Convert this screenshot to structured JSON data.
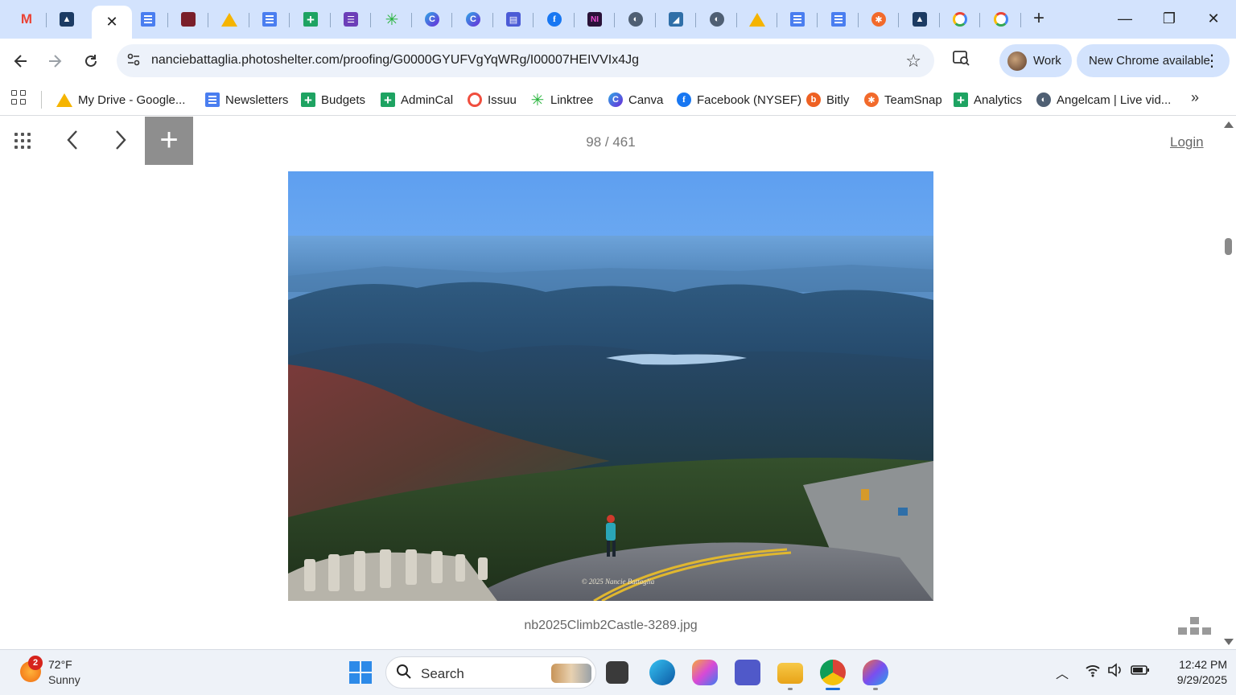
{
  "browser": {
    "active_tab_close": "✕",
    "new_tab": "+",
    "window_controls": {
      "minimize": "—",
      "restore": "❐",
      "close": "✕"
    },
    "url": "nanciebattaglia.photoshelter.com/proofing/G0000GYUFVgYqWRg/I00007HEIVVIx4Jg",
    "profile_label": "Work",
    "update_label": "New Chrome available"
  },
  "tabs": [
    {
      "icon": "gmail-icon",
      "glyph": "M"
    },
    {
      "icon": "photoshelter-icon",
      "glyph": "▲"
    },
    {
      "icon": "close-icon",
      "glyph": "✕",
      "active": true
    },
    {
      "icon": "google-docs-icon",
      "glyph": ""
    },
    {
      "icon": "unknown-site-icon",
      "glyph": ""
    },
    {
      "icon": "google-drive-icon",
      "glyph": ""
    },
    {
      "icon": "google-docs-icon",
      "glyph": ""
    },
    {
      "icon": "google-sheets-icon",
      "glyph": ""
    },
    {
      "icon": "google-forms-icon",
      "glyph": "☰"
    },
    {
      "icon": "linktree-icon",
      "glyph": "✳"
    },
    {
      "icon": "canva-icon",
      "glyph": "C"
    },
    {
      "icon": "canva-icon",
      "glyph": "C"
    },
    {
      "icon": "printer-icon",
      "glyph": "▤"
    },
    {
      "icon": "facebook-icon",
      "glyph": "f"
    },
    {
      "icon": "ni-icon",
      "glyph": "NI"
    },
    {
      "icon": "globe-icon",
      "glyph": "◐"
    },
    {
      "icon": "image-site-icon",
      "glyph": "◢"
    },
    {
      "icon": "globe-icon",
      "glyph": "◐"
    },
    {
      "icon": "google-drive-icon",
      "glyph": ""
    },
    {
      "icon": "google-docs-icon",
      "glyph": ""
    },
    {
      "icon": "google-docs-icon",
      "glyph": ""
    },
    {
      "icon": "teamsnap-icon",
      "glyph": "✱"
    },
    {
      "icon": "photoshelter-icon",
      "glyph": "▲"
    },
    {
      "icon": "google-icon",
      "glyph": "G"
    },
    {
      "icon": "google-icon",
      "glyph": "G"
    }
  ],
  "bookmarks": [
    {
      "label": "My Drive - Google...",
      "icon": "google-drive-icon"
    },
    {
      "label": "Newsletters",
      "icon": "google-docs-icon"
    },
    {
      "label": "Budgets",
      "icon": "google-sheets-icon"
    },
    {
      "label": "AdminCal",
      "icon": "google-sheets-icon"
    },
    {
      "label": "Issuu",
      "icon": "issuu-icon"
    },
    {
      "label": "Linktree",
      "icon": "linktree-icon"
    },
    {
      "label": "Canva",
      "icon": "canva-icon"
    },
    {
      "label": "Facebook (NYSEF)",
      "icon": "facebook-icon"
    },
    {
      "label": "Bitly",
      "icon": "bitly-icon"
    },
    {
      "label": "TeamSnap",
      "icon": "teamsnap-icon"
    },
    {
      "label": "Analytics",
      "icon": "google-sheets-icon"
    },
    {
      "label": "Angelcam | Live vid...",
      "icon": "globe-icon"
    }
  ],
  "page": {
    "counter": "98 / 461",
    "login": "Login",
    "add_glyph": "+",
    "prev_glyph": "〈",
    "next_glyph": "〉",
    "filename": "nb2025Climb2Castle-3289.jpg",
    "watermark": "© 2025 Nancie Battaglia"
  },
  "taskbar": {
    "weather_badge": "2",
    "temperature": "72°F",
    "condition": "Sunny",
    "search_label": "Search",
    "time": "12:42 PM",
    "date": "9/29/2025"
  }
}
